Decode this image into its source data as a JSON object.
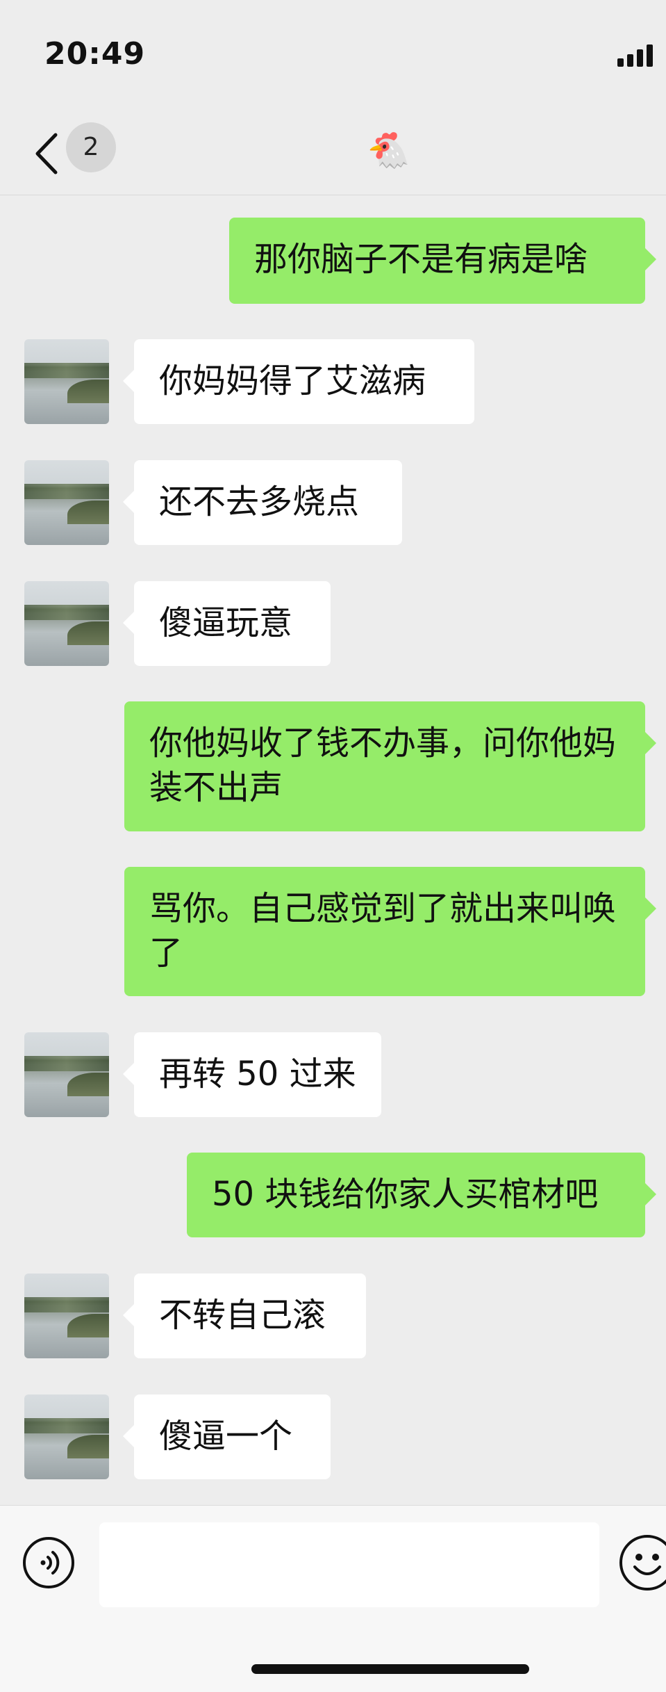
{
  "status": {
    "time": "20:49"
  },
  "header": {
    "unread_count": "2",
    "chat_title": "🐔"
  },
  "messages": [
    {
      "side": "out",
      "text": "那你脑子不是有病是啥"
    },
    {
      "side": "in",
      "text": "你妈妈得了艾滋病"
    },
    {
      "side": "in",
      "text": "还不去多烧点"
    },
    {
      "side": "in",
      "text": "傻逼玩意"
    },
    {
      "side": "out",
      "text": "你他妈收了钱不办事，问你他妈装不出声"
    },
    {
      "side": "out",
      "text": "骂你。自己感觉到了就出来叫唤了"
    },
    {
      "side": "in",
      "text": "再转 50 过来"
    },
    {
      "side": "out",
      "text": "50 块钱给你家人买棺材吧"
    },
    {
      "side": "in",
      "text": "不转自己滚"
    },
    {
      "side": "in",
      "text": "傻逼一个"
    }
  ],
  "input": {
    "value": ""
  },
  "colors": {
    "outgoing_bubble": "#95ec69",
    "incoming_bubble": "#ffffff",
    "background": "#ededed"
  }
}
